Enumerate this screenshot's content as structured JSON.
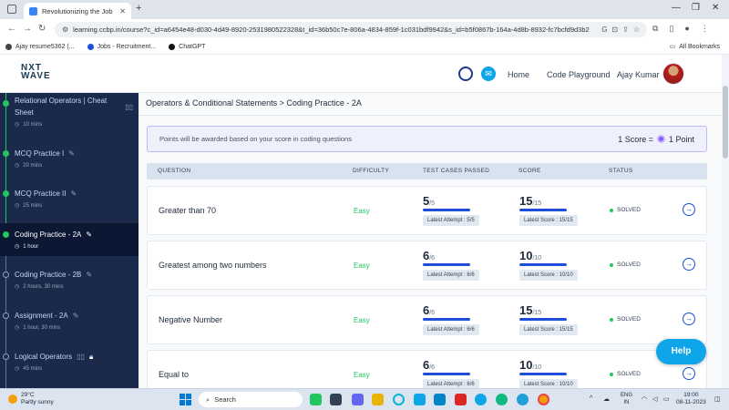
{
  "browser": {
    "tab_title": "Revolutionizing the Job Marke",
    "url": "learning.ccbp.in/course?c_id=a6454e48-d030-4d49-8920-2531980522328&t_id=36b50c7e-806a-4834-859f-1c031bdf9942&s_id=b5f0867b-164a-4d8b-8932-fc7bcfd9d3b2",
    "bookmarks": [
      "Ajay resume5362 (...",
      "Jobs - Recruitment...",
      "ChatGPT"
    ],
    "all_bookmarks": "All Bookmarks"
  },
  "header": {
    "logo_line1": "NXT",
    "logo_line2": "WAVE",
    "nav": [
      "Home",
      "Code Playground"
    ],
    "user_name": "Ajay Kumar"
  },
  "sidebar": {
    "items": [
      {
        "title": "Relational Operators | Cheat Sheet",
        "meta": "10 mins",
        "status": "done"
      },
      {
        "title": "MCQ Practice I",
        "meta": "20 mins",
        "status": "done"
      },
      {
        "title": "MCQ Practice II",
        "meta": "25 mins",
        "status": "done"
      },
      {
        "title": "Coding Practice - 2A",
        "meta": "1 hour",
        "status": "active"
      },
      {
        "title": "Coding Practice - 2B",
        "meta": "2 hours, 30 mins",
        "status": "open"
      },
      {
        "title": "Assignment - 2A",
        "meta": "1 hour, 30 mins",
        "status": "open"
      },
      {
        "title": "Logical Operators",
        "meta": "45 mins",
        "status": "open"
      }
    ]
  },
  "main": {
    "breadcrumb": "Operators & Conditional Statements > Coding Practice - 2A",
    "notice": "Points will be awarded based on your score in coding questions",
    "score_rule_left": "1 Score =",
    "score_rule_right": "1 Point",
    "columns": [
      "QUESTION",
      "DIFFICULTY",
      "TEST CASES PASSED",
      "SCORE",
      "STATUS"
    ],
    "rows": [
      {
        "question": "Greater than 70",
        "difficulty": "Easy",
        "passed": "5",
        "passed_total": "/5",
        "attempt": "Latest Attempt : 5/5",
        "score": "15",
        "score_total": "/15",
        "latest_score": "Latest Score : 15/15",
        "status": "SOLVED"
      },
      {
        "question": "Greatest among two numbers",
        "difficulty": "Easy",
        "passed": "6",
        "passed_total": "/6",
        "attempt": "Latest Attempt : 6/6",
        "score": "10",
        "score_total": "/10",
        "latest_score": "Latest Score : 10/10",
        "status": "SOLVED"
      },
      {
        "question": "Negative Number",
        "difficulty": "Easy",
        "passed": "6",
        "passed_total": "/6",
        "attempt": "Latest Attempt : 6/6",
        "score": "15",
        "score_total": "/15",
        "latest_score": "Latest Score : 15/15",
        "status": "SOLVED"
      },
      {
        "question": "Equal to",
        "difficulty": "Easy",
        "passed": "6",
        "passed_total": "/6",
        "attempt": "Latest Attempt : 6/6",
        "score": "10",
        "score_total": "/10",
        "latest_score": "Latest Score : 10/10",
        "status": "SOLVED"
      }
    ],
    "help_label": "Help"
  },
  "taskbar": {
    "temp": "29°C",
    "weather": "Partly sunny",
    "search": "Search",
    "lang1": "ENG",
    "lang2": "IN",
    "time": "19:00",
    "date": "08-11-2023"
  },
  "colors": {
    "sidebar_bg": "#1b2a4a",
    "accent_blue": "#1d4ed8",
    "success_green": "#22c55e",
    "help_button": "#0ea5e9"
  }
}
